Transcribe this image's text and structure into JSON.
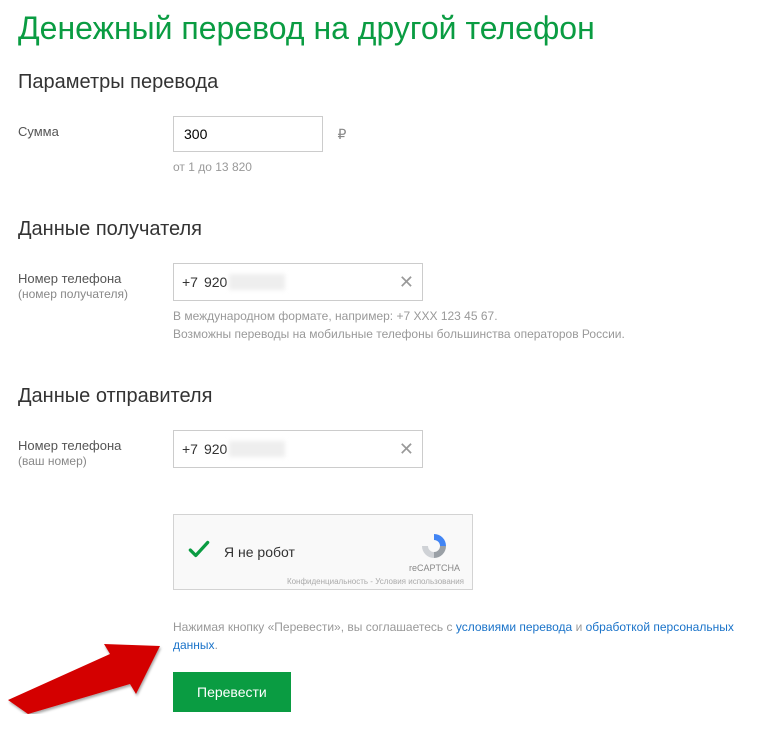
{
  "page_title": "Денежный перевод на другой телефон",
  "sections": {
    "params": {
      "title": "Параметры перевода"
    },
    "recipient": {
      "title": "Данные получателя"
    },
    "sender": {
      "title": "Данные отправителя"
    }
  },
  "amount": {
    "label": "Сумма",
    "value": "300",
    "currency": "₽",
    "hint": "от 1 до 13 820"
  },
  "recipient_phone": {
    "label": "Номер телефона",
    "sublabel": "(номер получателя)",
    "prefix": "+7",
    "value_visible": "920",
    "hint": "В международном формате, например: +7 XXX 123 45 67.\nВозможны переводы на мобильные телефоны большинства операторов России."
  },
  "sender_phone": {
    "label": "Номер телефона",
    "sublabel": "(ваш номер)",
    "prefix": "+7",
    "value_visible": "920"
  },
  "recaptcha": {
    "label": "Я не робот",
    "brand": "reCAPTCHA",
    "terms": "Конфиденциальность - Условия использования"
  },
  "agreement": {
    "prefix": "Нажимая кнопку «Перевести», вы соглашаетесь с ",
    "link1": "условиями перевода",
    "mid": " и ",
    "link2": "обработкой персональных данных",
    "suffix": "."
  },
  "submit_label": "Перевести"
}
